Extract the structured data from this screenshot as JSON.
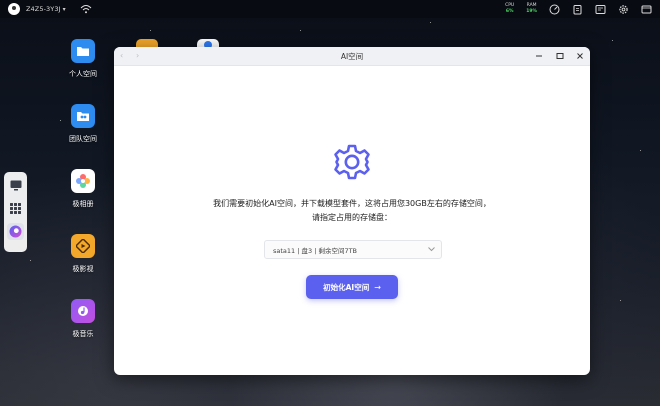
{
  "topbar": {
    "device_name": "Z4Z5-3Y3J",
    "cpu_label": "CPU",
    "cpu_value": "6%",
    "ram_label": "RAM",
    "ram_value": "19%"
  },
  "desktop": {
    "icons": [
      {
        "label": "个人空间"
      },
      {
        "label": "团队空间"
      },
      {
        "label": "极相册"
      },
      {
        "label": "极影视"
      },
      {
        "label": "极音乐"
      }
    ]
  },
  "window": {
    "title": "AI空间",
    "message": "我们需要初始化AI空间，并下载模型套件，这将占用您30GB左右的存储空间，请指定占用的存储盘：",
    "storage_option": "sata11 | 盘3 | 剩余空间7TB",
    "init_button_label": "初始化AI空间"
  },
  "colors": {
    "accent": "#5b60ee",
    "gear": "#5b60ee",
    "stat_green": "#4cd964"
  }
}
